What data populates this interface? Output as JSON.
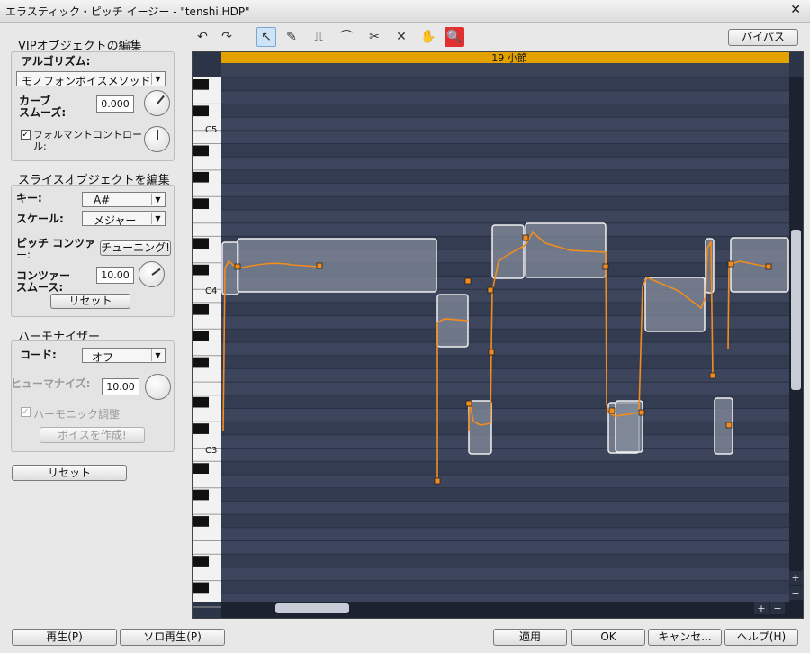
{
  "window": {
    "title": "エラスティック・ピッチ イージー - \"tenshi.HDP\"",
    "close_glyph": "✕"
  },
  "toolbar": {
    "undo": "↶",
    "redo": "↷",
    "pointer": "↖",
    "pencil": "✎",
    "step": "⎍",
    "smooth": "⌒",
    "scissors": "✂",
    "erase": "✕",
    "hand": "✋",
    "zoom": "🔍",
    "bypass": "バイパス"
  },
  "vip": {
    "title": "VIPオブジェクトの編集",
    "algorithm_label": "アルゴリズム:",
    "algorithm_value": "モノフォンボイスメソッド",
    "curve_label_1": "カーブ",
    "curve_label_2": "スムーズ:",
    "curve_value": "0.000",
    "formant_label_1": "フォルマントコントロー",
    "formant_label_2": "ル:"
  },
  "slice": {
    "title": "スライスオブジェクトを編集",
    "key_label": "キー:",
    "key_value": "A#",
    "scale_label": "スケール:",
    "scale_value": "メジャー",
    "contour_label_1": "ピッチ コンツァ",
    "contour_label_2": "ー:",
    "tuning_button": "チューニング!",
    "smooth_label_1": "コンツァー",
    "smooth_label_2": "スムース:",
    "smooth_value": "10.00",
    "reset_button": "リセット"
  },
  "harmonizer": {
    "title": "ハーモナイザー",
    "chord_label": "コード:",
    "chord_value": "オフ",
    "humanize_label": "ヒューマナイズ:",
    "humanize_value": "10.00",
    "harmonic_label": "ハーモニック調整",
    "create_voice_button": "ボイスを作成!"
  },
  "reset_all_button": "リセット",
  "timeline": {
    "bar_label": "19 小節"
  },
  "piano": {
    "c5": "C5",
    "c4": "C4",
    "c3": "C3"
  },
  "scroll": {
    "plus": "+",
    "minus": "−"
  },
  "footer": {
    "play": "再生(P)",
    "solo_play": "ソロ再生(P)",
    "apply": "適用",
    "ok": "OK",
    "cancel": "キャンセ...",
    "help": "ヘルプ(H)"
  },
  "colors": {
    "ruler": "#e3a200",
    "pitch": "#f28c1e",
    "note_border": "#f0f0f0"
  }
}
